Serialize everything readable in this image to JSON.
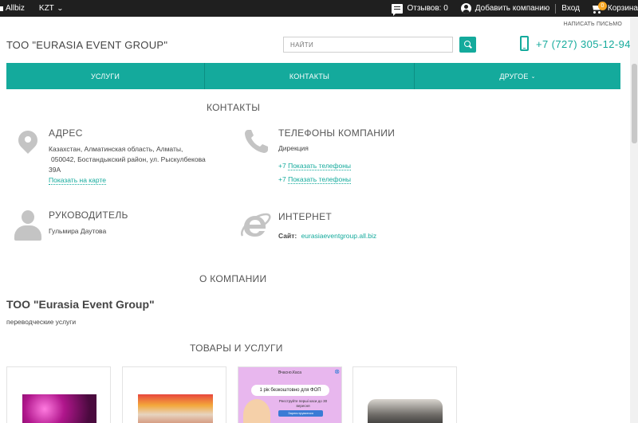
{
  "topbar": {
    "brand": "Allbiz",
    "currency": "KZT",
    "reviews": "Отзывов: 0",
    "add_company": "Добавить компанию",
    "login": "Вход",
    "cart": "Корзина",
    "cart_count": "0"
  },
  "header": {
    "write_letter": "НАПИСАТЬ ПИСЬМО",
    "company_title": "ТОО \"EURASIA EVENT GROUP\"",
    "search_placeholder": "НАЙТИ",
    "phone": "+7 (727) 305-12-94",
    "accent_color": "#14aa9c"
  },
  "nav": {
    "items": [
      {
        "label": "УСЛУГИ"
      },
      {
        "label": "КОНТАКТЫ"
      },
      {
        "label": "ДРУГОЕ"
      }
    ]
  },
  "contacts": {
    "section_title": "КОНТАКТЫ",
    "address": {
      "title": "АДРЕС",
      "line1": "Казахстан,  Алматинская область,  Алматы,",
      "line2": "050042,  Бостандыкский район, ул. Рыскулбекова",
      "line3": "39А",
      "map_link": "Показать на карте"
    },
    "phones": {
      "title": "ТЕЛЕФОНЫ КОМПАНИИ",
      "dept": "Дирекция",
      "rows": [
        {
          "prefix": "+7",
          "link": "Показать телефоны"
        },
        {
          "prefix": "+7",
          "link": "Показать телефоны"
        }
      ]
    },
    "manager": {
      "title": "РУКОВОДИТЕЛЬ",
      "name": "Гульмира Даутова"
    },
    "internet": {
      "title": "ИНТЕРНЕТ",
      "site_label": "Сайт:",
      "site": "eurasiaeventgroup.all.biz"
    }
  },
  "about": {
    "section_title": "О КОМПАНИИ",
    "company_name": "ТОО \"Eurasia Event Group\"",
    "description": "переводческие услуги"
  },
  "products": {
    "section_title": "ТОВАРЫ И УСЛУГИ",
    "ad": {
      "brand": "Вчасно.Каса",
      "headline": "1 рік безкоштовно для ФОП",
      "text": "Реєструйте перші каси до 30 вересня",
      "cta": "Зареєструватися"
    }
  }
}
